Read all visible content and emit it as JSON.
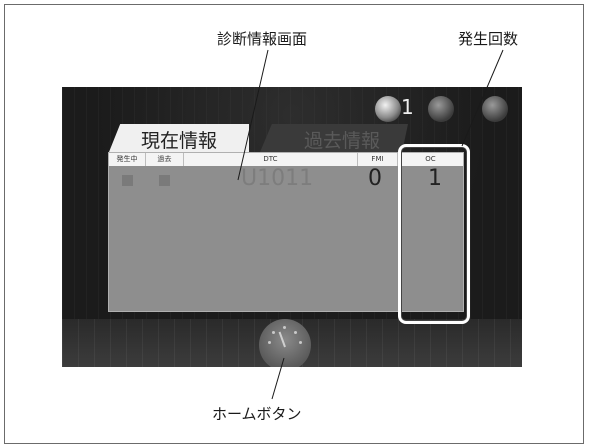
{
  "callouts": {
    "screen": "診断情報画面",
    "occurrence_count": "発生回数",
    "home_button": "ホームボタン"
  },
  "screen": {
    "badge_count": "1",
    "tabs": {
      "current": "現在情報",
      "past": "過去情報"
    },
    "table": {
      "headers": {
        "active": "発生中",
        "past": "過去",
        "dtc": "DTC",
        "fmi": "FMI",
        "oc": "OC"
      },
      "row": {
        "dtc": "U1011",
        "fmi": "0",
        "oc": "1"
      }
    }
  },
  "colors": {
    "screen_bg": "#1b1b1b",
    "table_bg": "#8e8e8e",
    "highlight": "#ffffff"
  }
}
